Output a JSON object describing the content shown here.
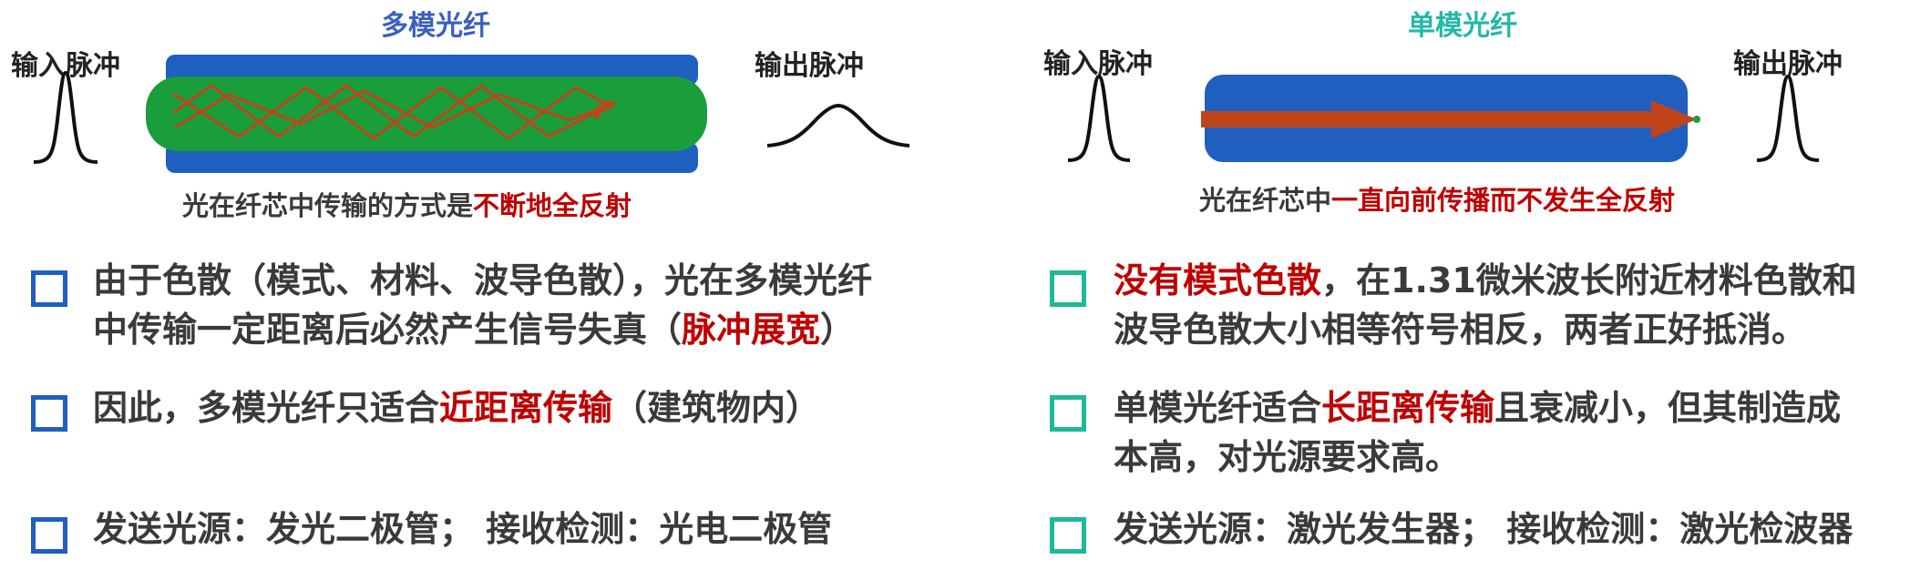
{
  "left": {
    "title": "多模光纤",
    "input_label": "输入脉冲",
    "output_label": "输出脉冲",
    "caption_pre": "光在纤芯中传输的方式是",
    "caption_hl": "不断地全反射",
    "points": [
      {
        "l1_pre": "由于色散（模式、材料、波导色散），光在多模光纤",
        "l1_hl": "",
        "l1_post": "",
        "l2_pre": "中传输一定距离后必然产生信号失真（",
        "l2_hl": "脉冲展宽",
        "l2_post": "）"
      },
      {
        "l1_pre": "因此，多模光纤只适合",
        "l1_hl": "近距离传输",
        "l1_post": "（建筑物内）",
        "l2_pre": "",
        "l2_hl": "",
        "l2_post": ""
      },
      {
        "l1_pre": "发送光源：发光二极管；  接收检测：光电二极管",
        "l1_hl": "",
        "l1_post": "",
        "l2_pre": "",
        "l2_hl": "",
        "l2_post": ""
      }
    ]
  },
  "right": {
    "title": "单模光纤",
    "input_label": "输入脉冲",
    "output_label": "输出脉冲",
    "caption_pre": "光在纤芯中",
    "caption_hl": "一直向前传播而不发生全反射",
    "points": [
      {
        "l1_pre": "",
        "l1_hl": "没有模式色散",
        "l1_post": "，在1.31微米波长附近材料色散和",
        "l2_pre": "波导色散大小相等符号相反，两者正好抵消。",
        "l2_hl": "",
        "l2_post": ""
      },
      {
        "l1_pre": "单模光纤适合",
        "l1_hl": "长距离传输",
        "l1_post": "且衰减小，但其制造成",
        "l2_pre": "本高，对光源要求高。",
        "l2_hl": "",
        "l2_post": ""
      },
      {
        "l1_pre": "发送光源：激光发生器；  接收检测：激光检波器",
        "l1_hl": "",
        "l1_post": "",
        "l2_pre": "",
        "l2_hl": "",
        "l2_post": ""
      }
    ]
  },
  "colors": {
    "cladding": "#1f5fbf",
    "multimode_core": "#1a9e3c",
    "singlemode_core": "#c0441a",
    "highlight": "#c00000",
    "left_title": "#3a5fbf",
    "right_title": "#22b8a8"
  },
  "icons": {
    "left_checkbox": "square-checkbox-blue",
    "right_checkbox": "square-checkbox-teal"
  }
}
